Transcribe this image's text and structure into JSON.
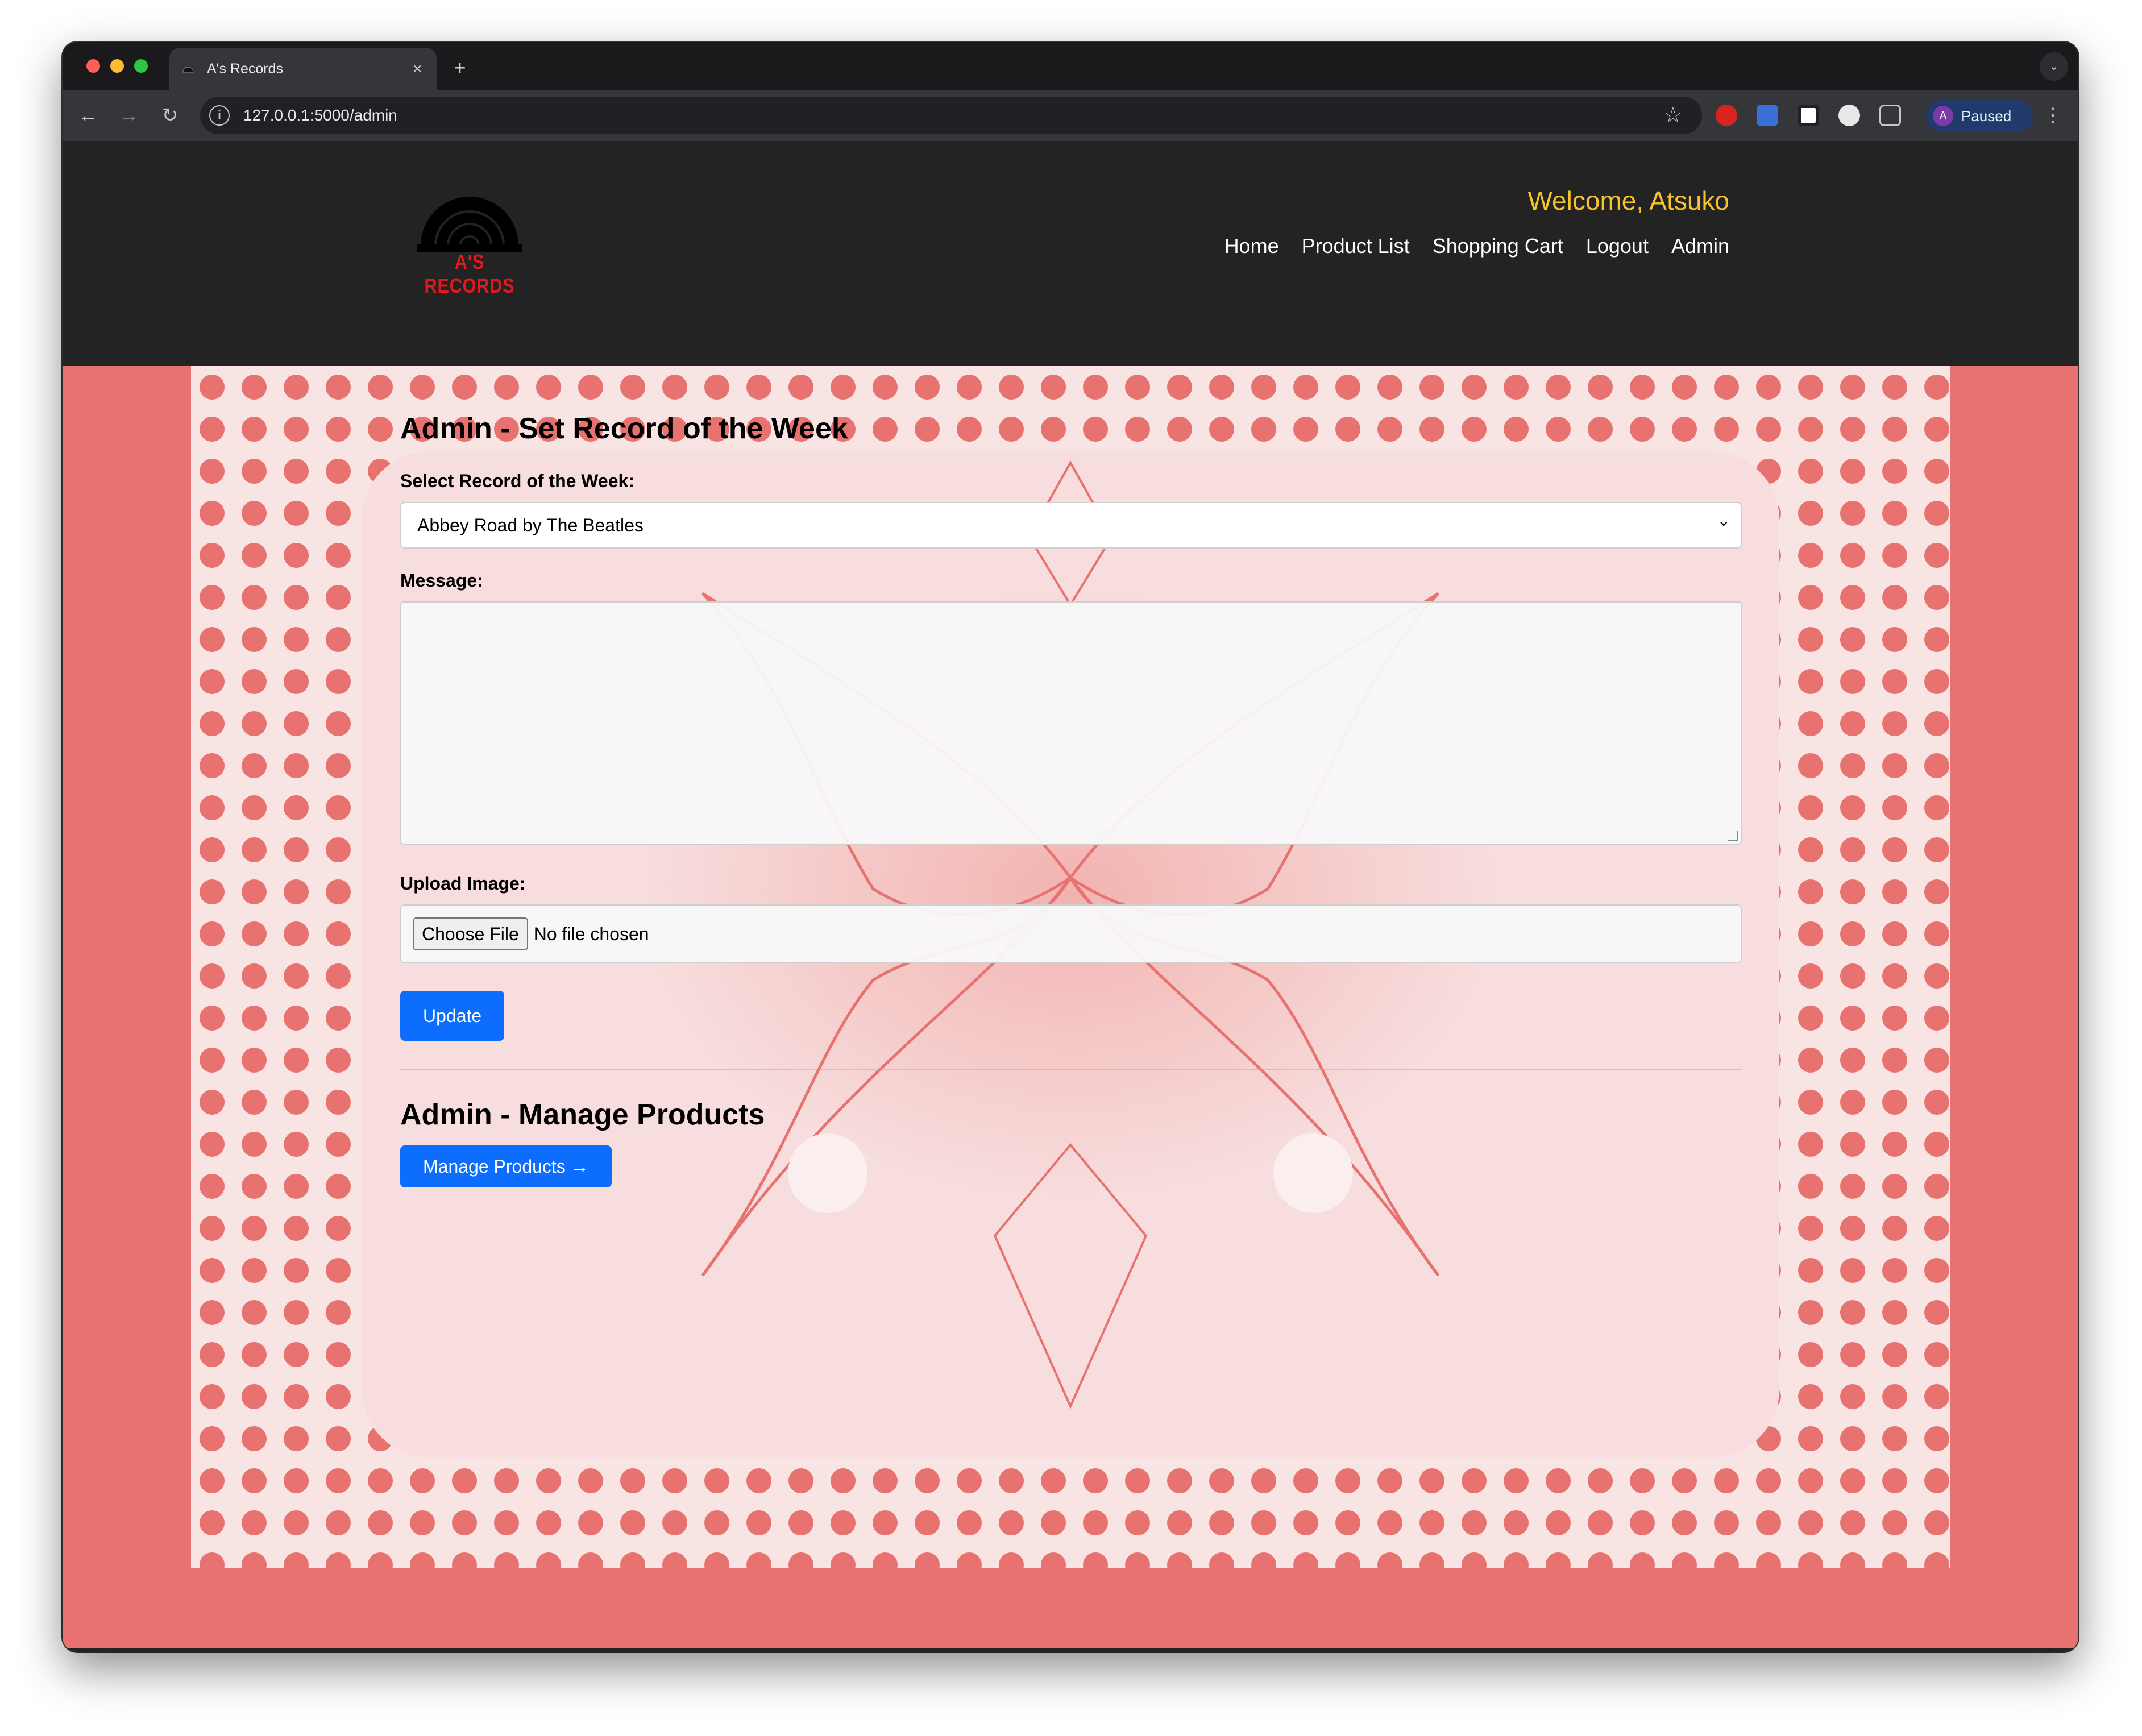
{
  "browser": {
    "tab_title": "A's Records",
    "tab_close": "×",
    "new_tab": "+",
    "url": "127.0.0.1:5000/admin",
    "profile_initial": "A",
    "profile_status": "Paused",
    "traffic_lights": [
      "#ff5f57",
      "#febc2e",
      "#28c840"
    ]
  },
  "header": {
    "logo_text": "A'S RECORDS",
    "welcome": "Welcome, Atsuko",
    "nav": [
      "Home",
      "Product List",
      "Shopping Cart",
      "Logout",
      "Admin"
    ]
  },
  "record_of_week": {
    "title": "Admin - Set Record of the Week",
    "select_label": "Select Record of the Week:",
    "selected_record": "Abbey Road by The Beatles",
    "message_label": "Message:",
    "message_value": "",
    "upload_label": "Upload Image:",
    "choose_file": "Choose File",
    "file_status": "No file chosen",
    "update_button": "Update"
  },
  "manage_products": {
    "title": "Admin - Manage Products",
    "button": "Manage Products →"
  },
  "colors": {
    "accent": "#0d6efd",
    "page_background": "#e77270",
    "header_background": "#232323",
    "welcome": "#f7c52b",
    "logo_red": "#e0191c"
  }
}
